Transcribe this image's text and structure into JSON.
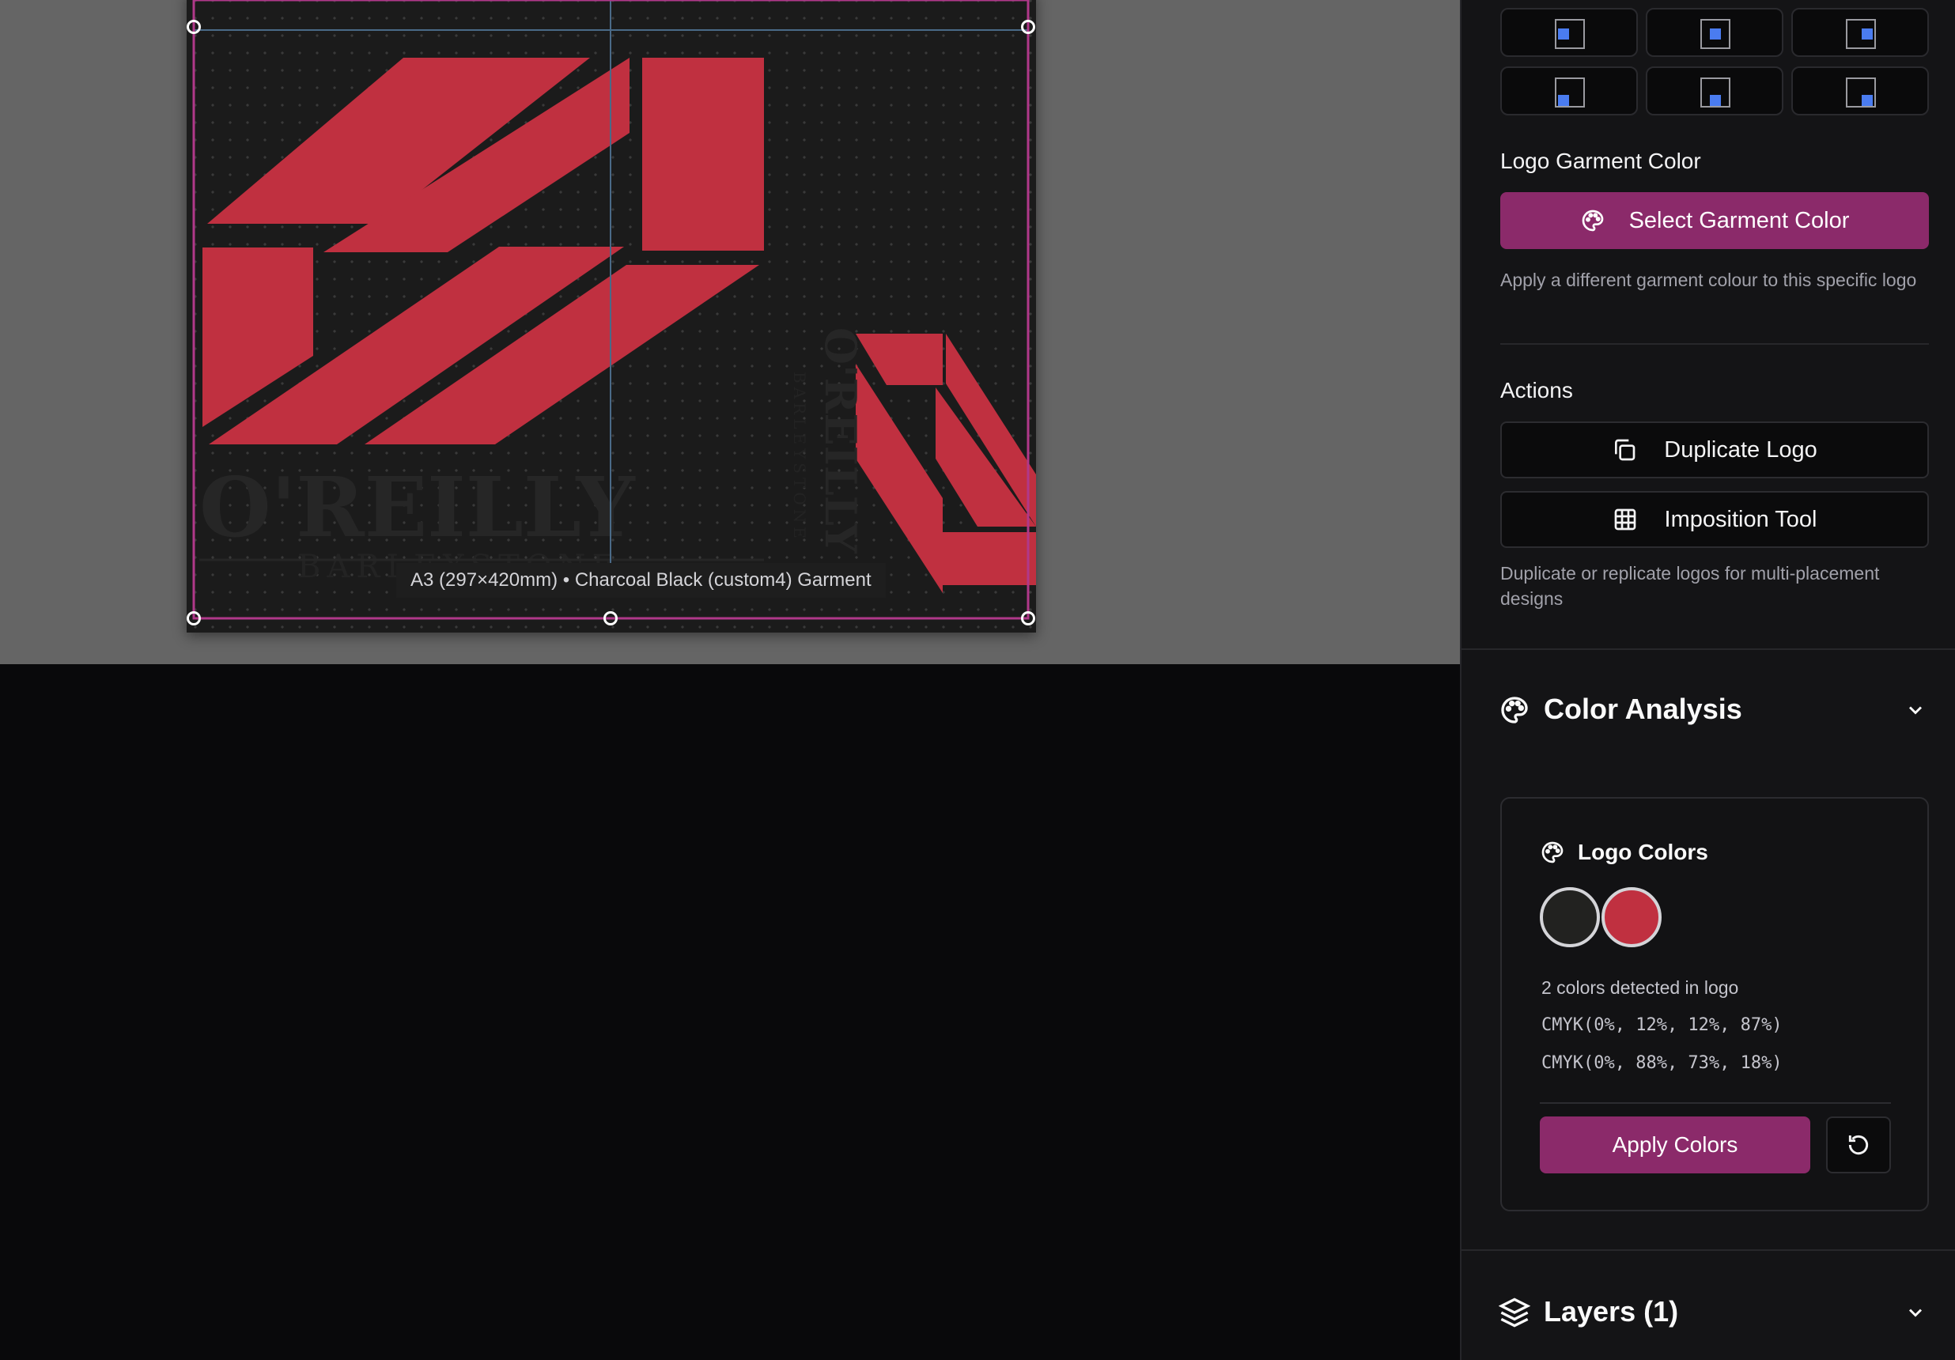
{
  "canvas": {
    "garment_label": "A3 (297×420mm) • Charcoal Black (custom4) Garment",
    "colors": {
      "workspace": "#656565",
      "artboard": "#1b1b1b",
      "logo_red": "#c03040",
      "selection": "#b0388a",
      "guide": "#4a6a88"
    }
  },
  "sidebar": {
    "position_grid": {
      "icons": [
        "align-middle-left-icon",
        "align-center-icon",
        "align-middle-right-icon",
        "align-bottom-left-icon",
        "align-bottom-center-icon",
        "align-bottom-right-icon"
      ],
      "accent": "#4a7cf0"
    },
    "garment_color": {
      "label": "Logo Garment Color",
      "button": "Select Garment Color",
      "help": "Apply a different garment colour to this specific logo"
    },
    "actions": {
      "label": "Actions",
      "duplicate": "Duplicate Logo",
      "imposition": "Imposition Tool",
      "help": "Duplicate or replicate logos for multi-placement designs"
    },
    "color_analysis": {
      "title": "Color Analysis",
      "card_title": "Logo Colors",
      "swatches": [
        "#222220",
        "#c03040"
      ],
      "detected": "2 colors detected in logo",
      "cmyk": [
        "CMYK(0%, 12%, 12%, 87%)",
        "CMYK(0%, 88%, 73%, 18%)"
      ],
      "apply": "Apply Colors"
    },
    "layers": {
      "title": "Layers (1)"
    },
    "accent": "#8b2a6a"
  }
}
